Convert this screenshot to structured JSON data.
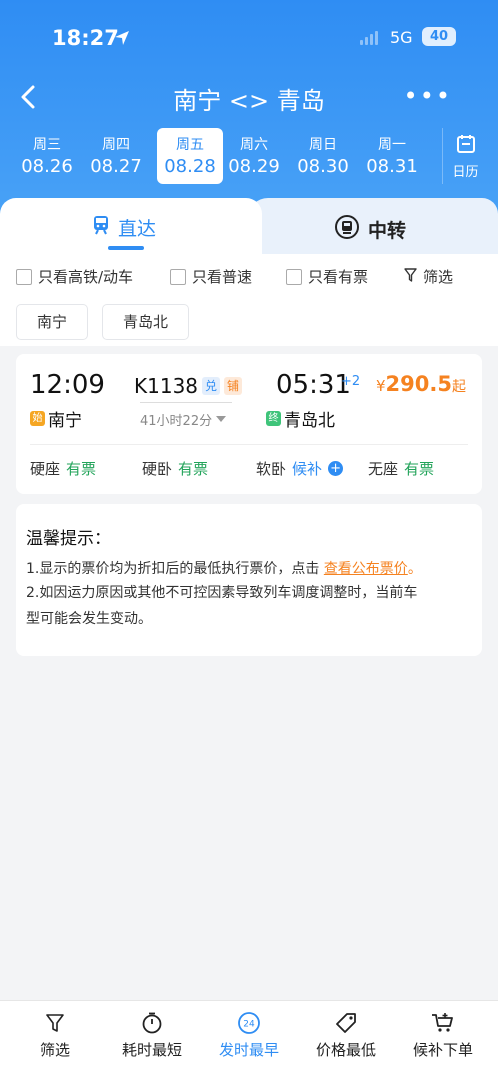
{
  "status_bar": {
    "time": "18:27",
    "network": "5G",
    "battery": "40"
  },
  "header": {
    "title": "南宁 <> 青岛"
  },
  "dates": [
    {
      "weekday": "周三",
      "date": "08.26",
      "selected": false
    },
    {
      "weekday": "周四",
      "date": "08.27",
      "selected": false
    },
    {
      "weekday": "周五",
      "date": "08.28",
      "selected": true
    },
    {
      "weekday": "周六",
      "date": "08.29",
      "selected": false
    },
    {
      "weekday": "周日",
      "date": "08.30",
      "selected": false
    },
    {
      "weekday": "周一",
      "date": "08.31",
      "selected": false
    }
  ],
  "calendar_label": "日历",
  "tabs": {
    "direct": "直达",
    "transfer": "中转"
  },
  "filters": {
    "high_speed": "只看高铁/动车",
    "normal": "只看普速",
    "available": "只看有票",
    "filter": "筛选"
  },
  "stations_chips": {
    "from": "南宁",
    "to": "青岛北"
  },
  "train": {
    "depart_time": "12:09",
    "arrive_time": "05:31",
    "days_plus": "+2",
    "train_no": "K1138",
    "tag_dui": "兑",
    "tag_pu": "铺",
    "duration": "41小时22分",
    "price_symbol": "¥",
    "price": "290.5",
    "price_suffix": "起",
    "start_tag": "始",
    "from_station": "南宁",
    "end_tag": "终",
    "to_station": "青岛北",
    "seats": [
      {
        "type": "硬座",
        "status": "有票"
      },
      {
        "type": "硬卧",
        "status": "有票"
      },
      {
        "type": "软卧",
        "status": "候补"
      },
      {
        "type": "无座",
        "status": "有票"
      }
    ]
  },
  "tips": {
    "title": "温馨提示：",
    "line1_prefix": "1.显示的票价均为折扣后的最低执行票价，点击",
    "line1_link": "查看公布票价",
    "line1_suffix": "。",
    "line2a": "2.如因运力原因或其他不可控因素导致列车调度调整时，当前车",
    "line2b": "型可能会发生变动。"
  },
  "bottom_bar": {
    "filter": "筛选",
    "shortest": "耗时最短",
    "earliest": "发时最早",
    "cheapest": "价格最低",
    "waitlist": "候补下单",
    "earliest_icon_text": "24"
  },
  "colors": {
    "primary": "#2f8df3",
    "price": "#f58220",
    "available": "#22a35a"
  },
  "icons": [
    "location-arrow-icon",
    "back-icon",
    "more-icon",
    "calendar-icon",
    "train-icon",
    "transfer-icon",
    "filter-icon",
    "chevron-down-icon",
    "plus-icon",
    "timer-icon",
    "clock-24-icon",
    "price-tag-icon",
    "cart-icon"
  ]
}
